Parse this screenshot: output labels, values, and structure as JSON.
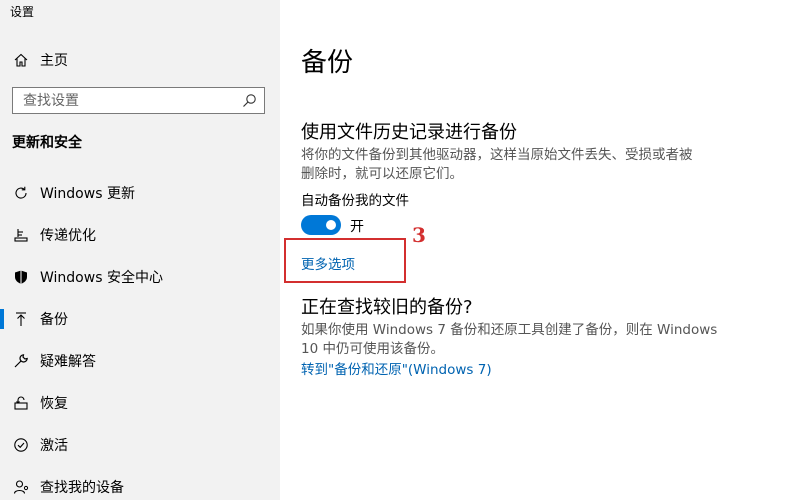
{
  "window": {
    "title": "设置"
  },
  "sidebar": {
    "home_label": "主页",
    "search_placeholder": "查找设置",
    "section_title": "更新和安全",
    "items": [
      {
        "label": "Windows 更新",
        "icon": "refresh-icon"
      },
      {
        "label": "传递优化",
        "icon": "delivery-optimization-icon"
      },
      {
        "label": "Windows 安全中心",
        "icon": "shield-icon"
      },
      {
        "label": "备份",
        "icon": "backup-upload-icon",
        "active": true
      },
      {
        "label": "疑难解答",
        "icon": "wrench-icon"
      },
      {
        "label": "恢复",
        "icon": "recovery-icon"
      },
      {
        "label": "激活",
        "icon": "activation-check-icon"
      },
      {
        "label": "查找我的设备",
        "icon": "person-location-icon"
      }
    ]
  },
  "main": {
    "title": "备份",
    "file_history": {
      "heading": "使用文件历史记录进行备份",
      "desc_line1": "将你的文件备份到其他驱动器，这样当原始文件丢失、受损或者被",
      "desc_line2": "删除时，就可以还原它们。",
      "auto_label": "自动备份我的文件",
      "toggle_state": "开",
      "more_options": "更多选项"
    },
    "older_backup": {
      "heading": "正在查找较旧的备份?",
      "desc_line1": "如果你使用 Windows 7 备份和还原工具创建了备份，则在 Windows",
      "desc_line2": "10 中仍可使用该备份。",
      "link": "转到\"备份和还原\"(Windows 7)"
    }
  },
  "annotation": {
    "number": "3",
    "color": "#d32f2f"
  },
  "colors": {
    "accent": "#0078d7",
    "link": "#0063b1",
    "sidebar_bg": "#f2f2f2"
  }
}
